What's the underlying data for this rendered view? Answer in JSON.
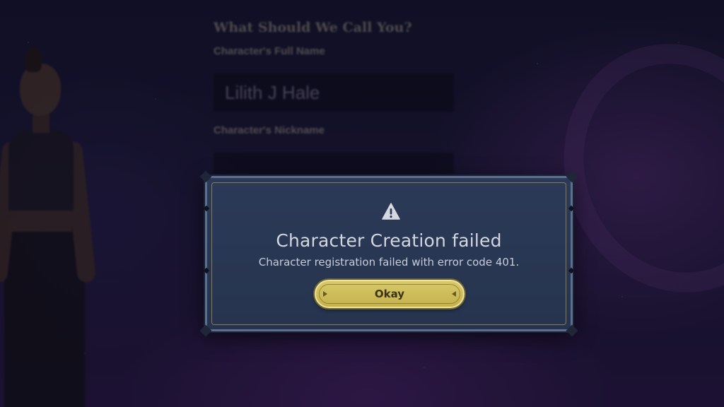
{
  "background_form": {
    "heading": "What Should We Call You?",
    "full_name_label": "Character's Full Name",
    "full_name_hint": "",
    "full_name_value": "Lilith J Hale",
    "nickname_label": "Character's Nickname",
    "nickname_hint": "",
    "nickname_value": ""
  },
  "dialog": {
    "icon": "warning-triangle-icon",
    "title": "Character Creation failed",
    "message": "Character registration failed with error code 401.",
    "okay_label": "Okay"
  },
  "colors": {
    "dialog_bg": "#2b3a57",
    "dialog_border": "#5d6f8f",
    "button_gold": "#d8c96a",
    "title_text": "#d4d6de"
  }
}
